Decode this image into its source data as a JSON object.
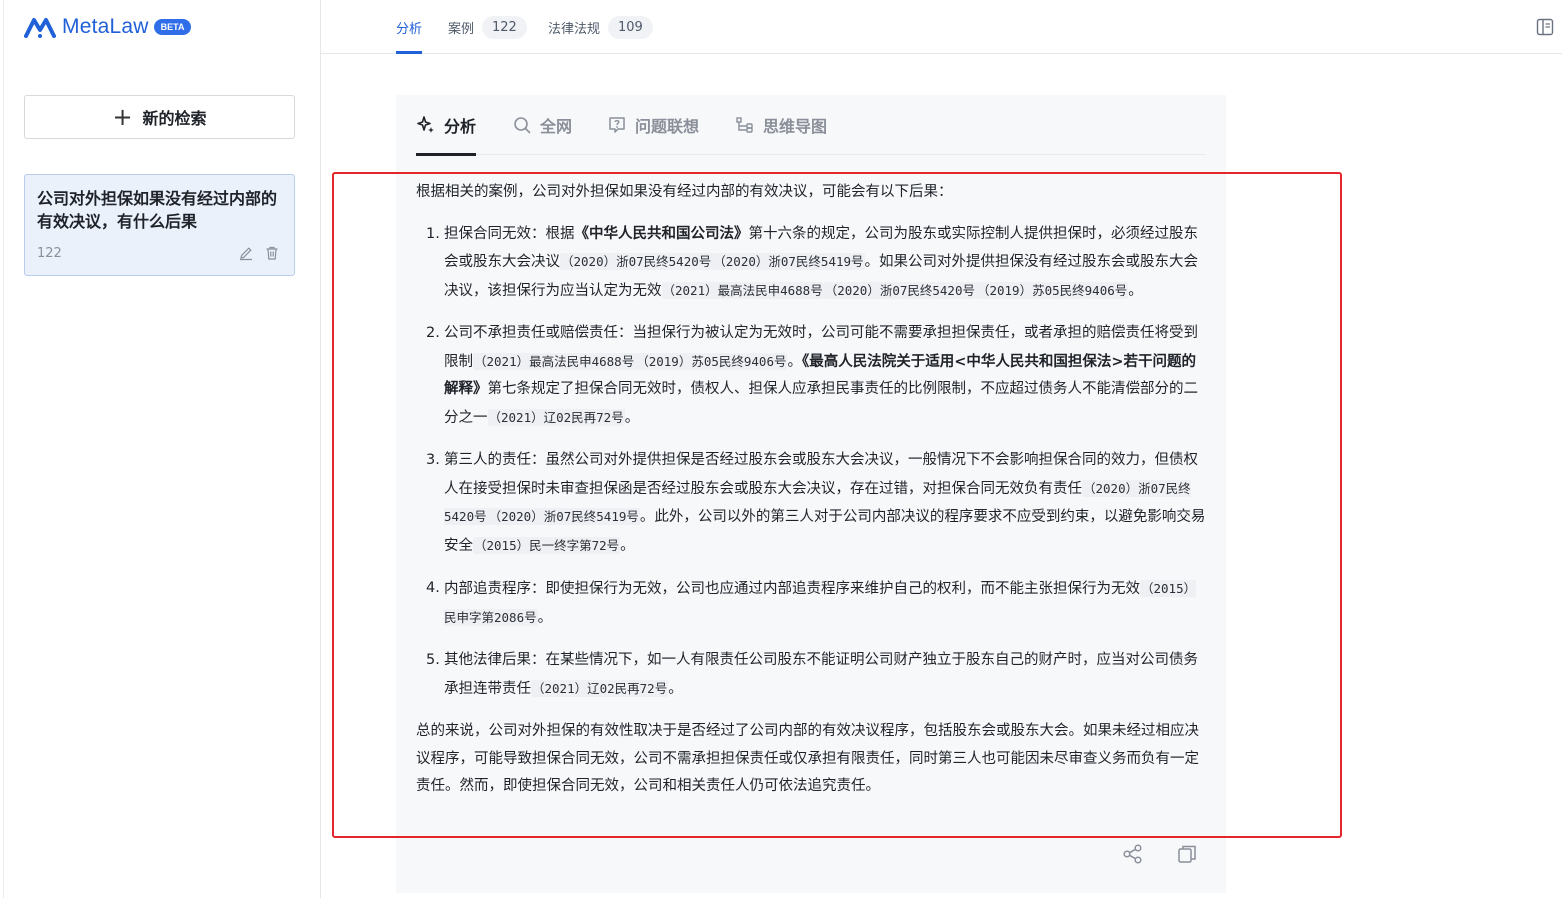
{
  "brand": {
    "name": "MetaLaw",
    "badge": "BETA"
  },
  "sidebar": {
    "new_search_label": "新的检索",
    "history": [
      {
        "title": "公司对外担保如果没有经过内部的有效决议，有什么后果",
        "count": "122"
      }
    ]
  },
  "top_tabs": [
    {
      "label": "分析",
      "count": ""
    },
    {
      "label": "案例",
      "count": "122"
    },
    {
      "label": "法律法规",
      "count": "109"
    }
  ],
  "sub_tabs": [
    {
      "label": "分析",
      "icon": "sparkle-icon"
    },
    {
      "label": "全网",
      "icon": "search-icon"
    },
    {
      "label": "问题联想",
      "icon": "question-bubble-icon"
    },
    {
      "label": "思维导图",
      "icon": "mindmap-icon"
    }
  ],
  "answer": {
    "intro": "根据相关的案例，公司对外担保如果没有经过内部的有效决议，可能会有以下后果：",
    "items": [
      {
        "num": "1.",
        "segments": [
          {
            "t": "text",
            "v": "担保合同无效：根据"
          },
          {
            "t": "bold",
            "v": "《中华人民共和国公司法》"
          },
          {
            "t": "text",
            "v": "第十六条的规定，公司为股东或实际控制人提供担保时，必须经过股东会或股东大会决议"
          },
          {
            "t": "cite",
            "v": "（2020）浙07民终5420号"
          },
          {
            "t": "cite",
            "v": "（2020）浙07民终5419号"
          },
          {
            "t": "text",
            "v": "。如果公司对外提供担保没有经过股东会或股东大会决议，该担保行为应当认定为无效"
          },
          {
            "t": "cite",
            "v": "（2021）最高法民申4688号"
          },
          {
            "t": "cite",
            "v": "（2020）浙07民终5420号"
          },
          {
            "t": "cite",
            "v": "（2019）苏05民终9406号"
          },
          {
            "t": "text",
            "v": "。"
          }
        ]
      },
      {
        "num": "2.",
        "segments": [
          {
            "t": "text",
            "v": "公司不承担责任或赔偿责任：当担保行为被认定为无效时，公司可能不需要承担担保责任，或者承担的赔偿责任将受到限制"
          },
          {
            "t": "cite",
            "v": "（2021）最高法民申4688号"
          },
          {
            "t": "cite",
            "v": "（2019）苏05民终9406号"
          },
          {
            "t": "text",
            "v": "。"
          },
          {
            "t": "bold",
            "v": "《最高人民法院关于适用<中华人民共和国担保法>若干问题的解释》"
          },
          {
            "t": "text",
            "v": "第七条规定了担保合同无效时，债权人、担保人应承担民事责任的比例限制，不应超过债务人不能清偿部分的二分之一"
          },
          {
            "t": "cite",
            "v": "（2021）辽02民再72号"
          },
          {
            "t": "text",
            "v": "。"
          }
        ]
      },
      {
        "num": "3.",
        "segments": [
          {
            "t": "text",
            "v": "第三人的责任：虽然公司对外提供担保是否经过股东会或股东大会决议，一般情况下不会影响担保合同的效力，但债权人在接受担保时未审查担保函是否经过股东会或股东大会决议，存在过错，对担保合同无效负有责任"
          },
          {
            "t": "cite",
            "v": "（2020）浙07民终5420号"
          },
          {
            "t": "cite",
            "v": "（2020）浙07民终5419号"
          },
          {
            "t": "text",
            "v": "。此外，公司以外的第三人对于公司内部决议的程序要求不应受到约束，以避免影响交易安全"
          },
          {
            "t": "cite",
            "v": "（2015）民一终字第72号"
          },
          {
            "t": "text",
            "v": "。"
          }
        ]
      },
      {
        "num": "4.",
        "segments": [
          {
            "t": "text",
            "v": "内部追责程序：即使担保行为无效，公司也应通过内部追责程序来维护自己的权利，而不能主张担保行为无效"
          },
          {
            "t": "cite",
            "v": "（2015）民申字第2086号"
          },
          {
            "t": "text",
            "v": "。"
          }
        ]
      },
      {
        "num": "5.",
        "segments": [
          {
            "t": "text",
            "v": "其他法律后果：在某些情况下，如一人有限责任公司股东不能证明公司财产独立于股东自己的财产时，应当对公司债务承担连带责任"
          },
          {
            "t": "cite",
            "v": "（2021）辽02民再72号"
          },
          {
            "t": "text",
            "v": "。"
          }
        ]
      }
    ],
    "summary": "总的来说，公司对外担保的有效性取决于是否经过了公司内部的有效决议程序，包括股东会或股东大会。如果未经过相应决议程序，可能导致担保合同无效，公司不需承担担保责任或仅承担有限责任，同时第三人也可能因未尽审查义务而负有一定责任。然而，即使担保合同无效，公司和相关责任人仍可依法追究责任。"
  },
  "colors": {
    "accent": "#2060d8",
    "highlight": "#e3262b",
    "panel_bg": "#f7f8fa"
  }
}
